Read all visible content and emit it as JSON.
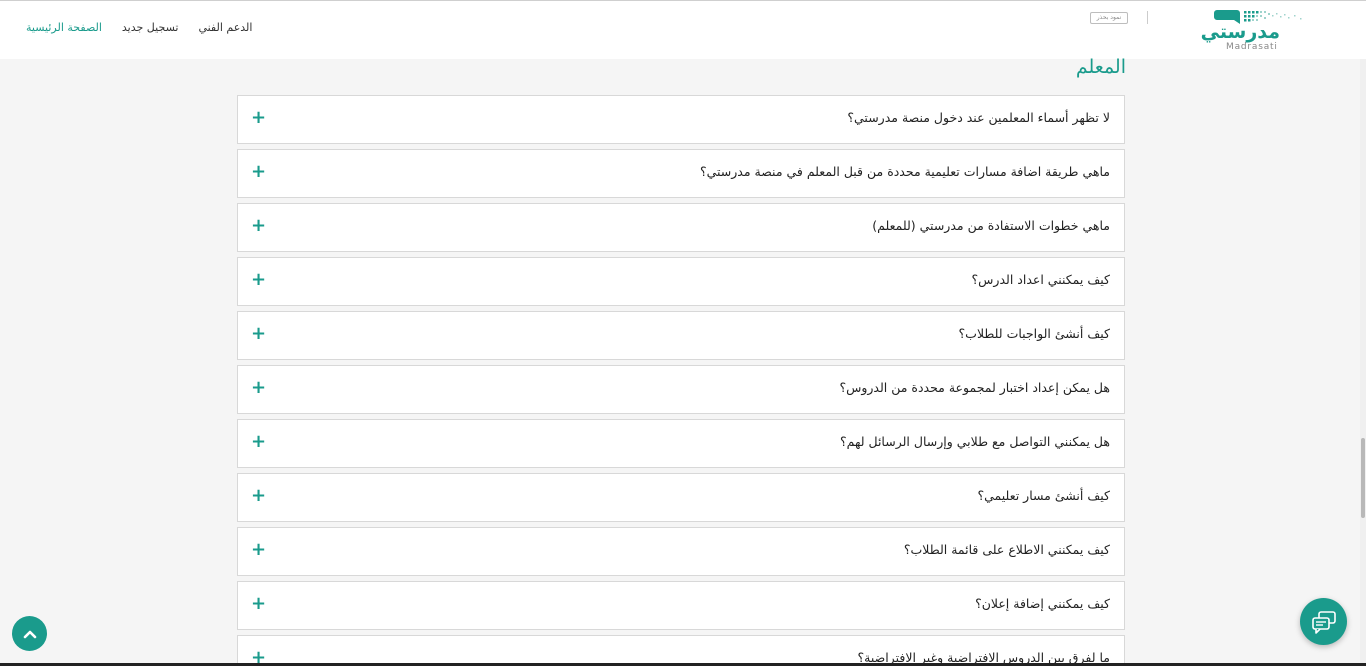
{
  "nav": {
    "home": "الصفحة الرئيسية",
    "register": "تسجيل جديد",
    "support": "الدعم الفني"
  },
  "brand": {
    "tag": "نمود بحذر",
    "logo_ar": "مدرستي",
    "logo_en": "Madrasati"
  },
  "section": {
    "title": "المعلم"
  },
  "faq": [
    "لا تظهر أسماء المعلمين عند دخول منصة مدرستي؟",
    "ماهي طريقة اضافة مسارات تعليمية محددة من قبل المعلم في منصة مدرستي؟",
    "ماهي خطوات الاستفادة من مدرستي (للمعلم)",
    "كيف يمكنني اعداد الدرس؟",
    "كيف أنشئ الواجبات للطلاب؟",
    "هل يمكن إعداد اختبار لمجموعة محددة من الدروس؟",
    "هل يمكنني التواصل مع طلابي وإرسال الرسائل لهم؟",
    "كيف أنشئ مسار تعليمي؟",
    "كيف يمكنني الاطلاع على قائمة الطلاب؟",
    "كيف يمكنني إضافة إعلان؟",
    "ما لفرق بين الدروس الافتراضية وغير الافتراضية؟"
  ],
  "expand_symbol": "+",
  "colors": {
    "accent": "#1a9b8c"
  },
  "icons": {
    "scroll_top": "chevron-up-icon",
    "chat": "chat-icon"
  }
}
